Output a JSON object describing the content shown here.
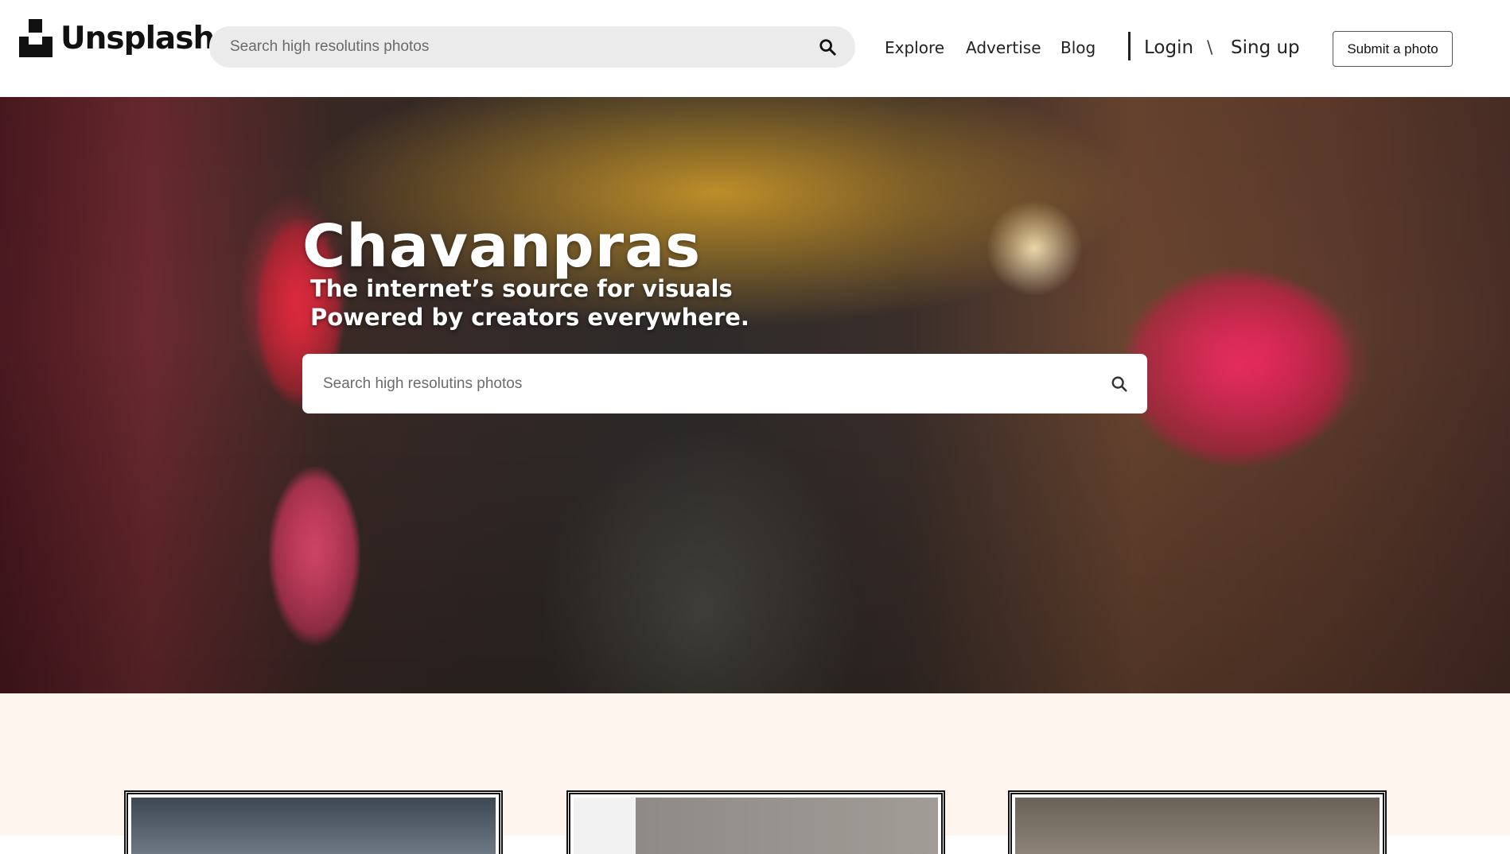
{
  "header": {
    "logo_text": "Unsplash",
    "search_placeholder": "Search high resolutins photos",
    "nav": {
      "explore": "Explore",
      "advertise": "Advertise",
      "blog": "Blog",
      "login": "Login",
      "separator": "\\",
      "signup": "Sing up"
    },
    "submit_label": "Submit a photo"
  },
  "hero": {
    "title": "Chavanpras",
    "subtitle_line1": "The internet’s source for visuals",
    "subtitle_line2": "Powered by creators everywhere.",
    "search_placeholder": "Search high resolutins photos"
  },
  "icons": {
    "logo": "unsplash-logo-icon",
    "search": "search-icon"
  },
  "colors": {
    "section_bg": "#fdf5ee",
    "search_bg": "#ebebeb"
  },
  "gallery": {
    "cards": [
      "photo-card-1",
      "photo-card-2",
      "photo-card-3"
    ]
  }
}
